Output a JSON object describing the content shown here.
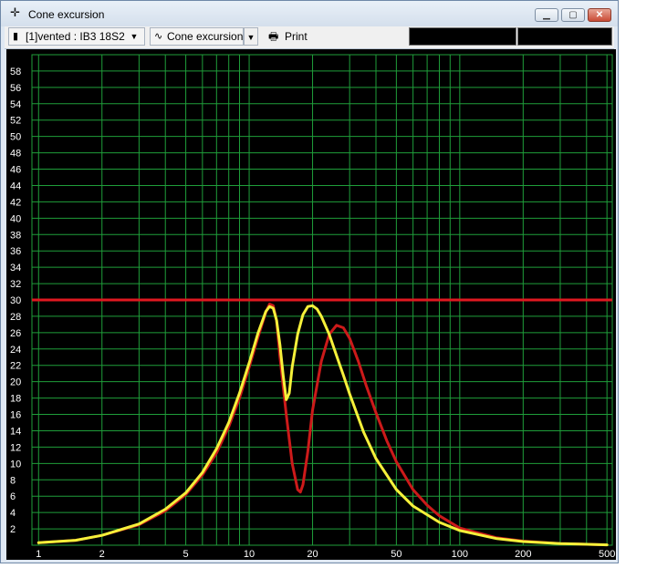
{
  "window": {
    "title": "Cone excursion"
  },
  "titlebar_icons": {
    "app": "crosshair-icon",
    "minimize": "minimize-icon",
    "maximize": "maximize-icon",
    "close": "close-icon"
  },
  "toolbar": {
    "project_selector": "[1]vented : IB3 18S2",
    "graph_selector": "Cone excursion",
    "print_label": "Print"
  },
  "colors": {
    "background": "#000000",
    "grid": "#1f9e3a",
    "axis_text": "#ffffff",
    "limit": "#e01820",
    "red_series": "#cc1a1a",
    "yellow_series": "#f5f03a"
  },
  "chart_data": {
    "type": "line",
    "title": "",
    "xlabel": "",
    "ylabel": "",
    "xscale": "log",
    "xlim": [
      0.93,
      530
    ],
    "ylim": [
      0,
      60
    ],
    "xticks": [
      1,
      2,
      5,
      10,
      20,
      50,
      100,
      200,
      500
    ],
    "yticks": [
      2,
      4,
      6,
      8,
      10,
      12,
      14,
      16,
      18,
      20,
      22,
      24,
      26,
      28,
      30,
      32,
      34,
      36,
      38,
      40,
      42,
      44,
      46,
      48,
      50,
      52,
      54,
      56,
      58
    ],
    "grid": true,
    "limit_line": {
      "y": 30
    },
    "series": [
      {
        "color": "red",
        "x": [
          1,
          1.5,
          2,
          3,
          4,
          5,
          6,
          7,
          8,
          9,
          10,
          11,
          12,
          12.5,
          13,
          13.5,
          14,
          15,
          16,
          17,
          17.5,
          18,
          19,
          20,
          22,
          24,
          26,
          28,
          30,
          33,
          36,
          40,
          45,
          50,
          60,
          70,
          80,
          100,
          150,
          200,
          300,
          500
        ],
        "y": [
          0.3,
          0.6,
          1.2,
          2.5,
          4.2,
          6.2,
          8.6,
          11.3,
          14.5,
          18.0,
          21.8,
          25.4,
          28.5,
          29.5,
          29.3,
          27.5,
          23.0,
          16.0,
          10.0,
          6.8,
          6.5,
          7.4,
          11.5,
          16.5,
          22.5,
          25.8,
          26.9,
          26.6,
          25.3,
          22.5,
          19.5,
          16.2,
          12.8,
          10.2,
          6.8,
          4.9,
          3.6,
          2.1,
          0.9,
          0.5,
          0.2,
          0.05
        ]
      },
      {
        "color": "yellow",
        "x": [
          1,
          1.5,
          2,
          3,
          4,
          5,
          6,
          7,
          8,
          9,
          10,
          11,
          12,
          12.5,
          13,
          13.5,
          14,
          14.5,
          15,
          15.5,
          16,
          17,
          18,
          19,
          20,
          21,
          22,
          24,
          26,
          28,
          30,
          35,
          40,
          50,
          60,
          80,
          100,
          150,
          200,
          300,
          500
        ],
        "y": [
          0.3,
          0.6,
          1.2,
          2.6,
          4.4,
          6.4,
          8.9,
          11.8,
          15.0,
          18.6,
          22.3,
          25.9,
          28.6,
          29.2,
          29.0,
          27.5,
          24.5,
          20.8,
          17.8,
          18.6,
          21.8,
          25.8,
          28.2,
          29.2,
          29.3,
          28.9,
          28.0,
          25.8,
          23.2,
          20.8,
          18.5,
          13.8,
          10.6,
          6.8,
          4.8,
          2.8,
          1.8,
          0.8,
          0.45,
          0.2,
          0.05
        ]
      }
    ]
  }
}
